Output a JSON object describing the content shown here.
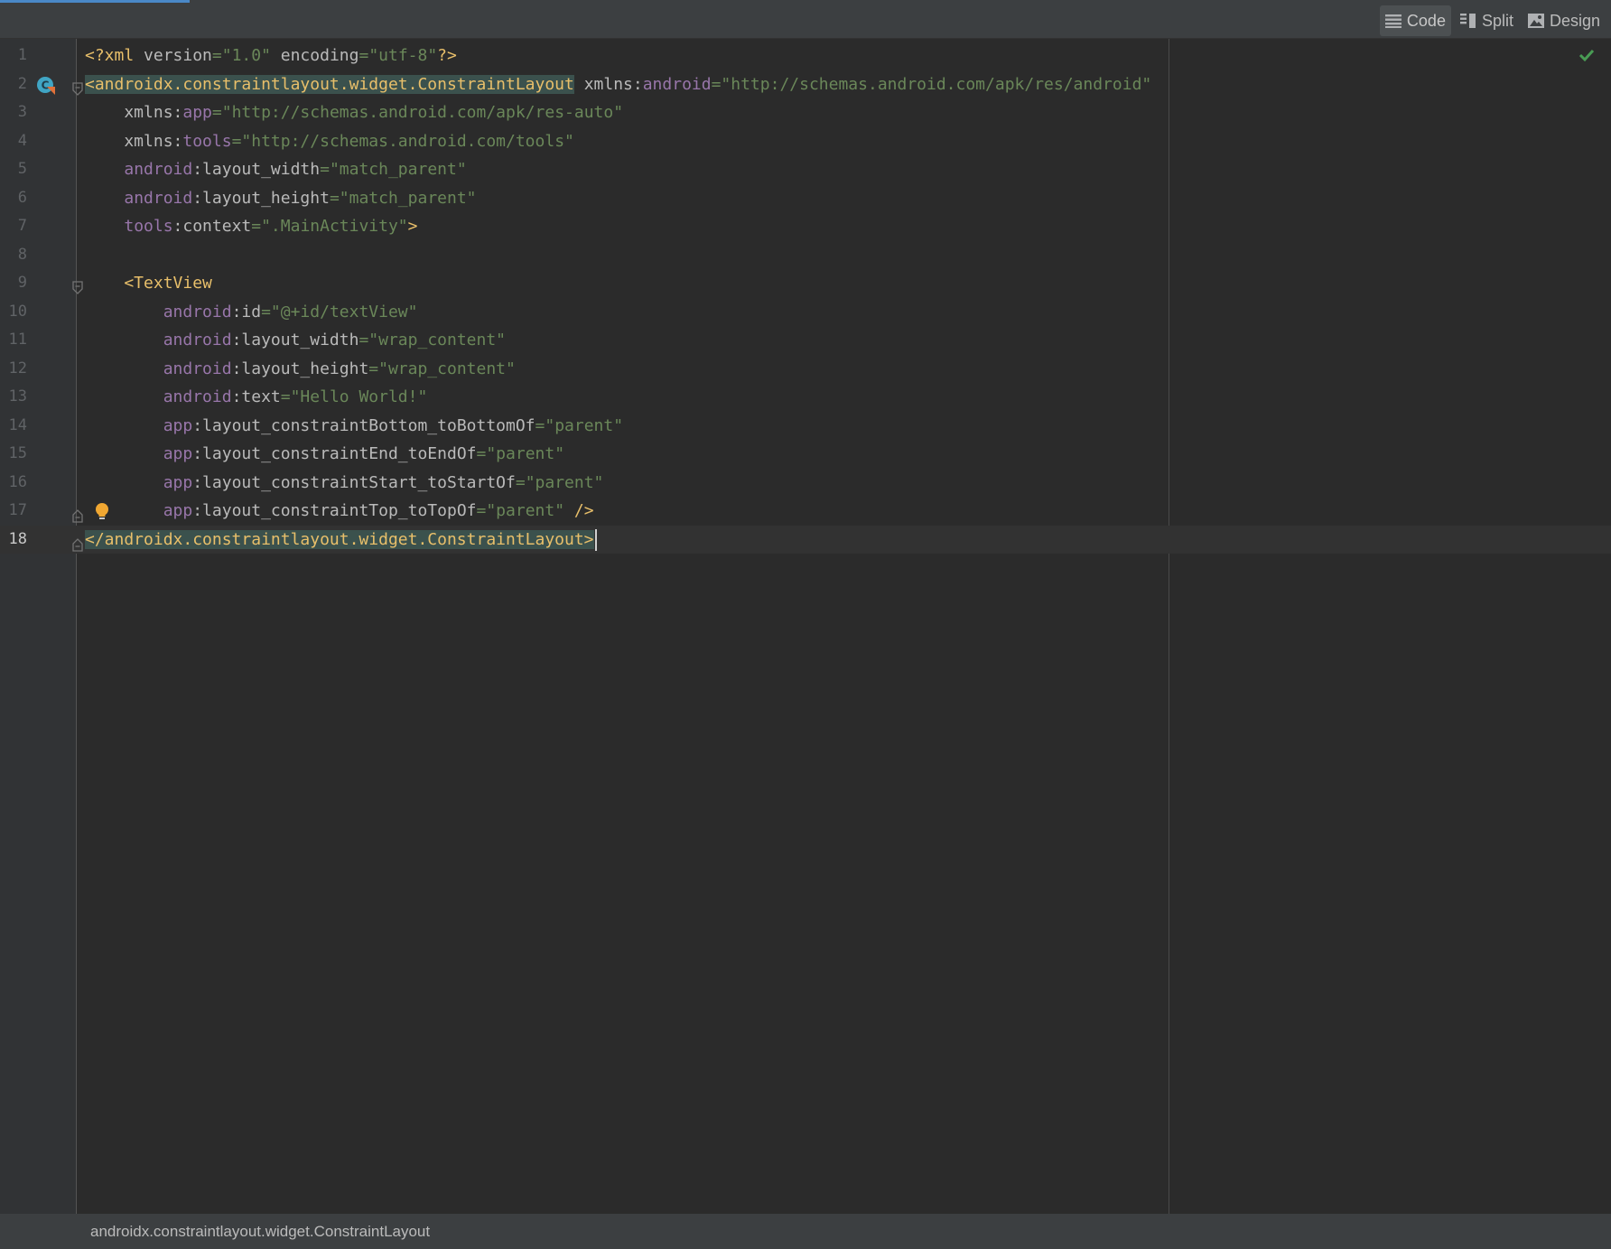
{
  "view_modes": {
    "code_label": "Code",
    "split_label": "Split",
    "design_label": "Design",
    "active": "Code"
  },
  "editor": {
    "current_line": 18,
    "lines": [
      {
        "n": "1",
        "tokens": [
          [
            "<?xml ",
            "t"
          ],
          [
            "version",
            "a"
          ],
          [
            "=",
            "v"
          ],
          [
            "\"1.0\"",
            "v"
          ],
          [
            " encoding",
            "a"
          ],
          [
            "=",
            "v"
          ],
          [
            "\"utf-8\"",
            "v"
          ],
          [
            "?>",
            "t"
          ]
        ]
      },
      {
        "n": "2",
        "tokens": [
          [
            "<androidx.constraintlayout.widget.ConstraintLayout",
            "t hl"
          ],
          [
            " xmlns:",
            "a"
          ],
          [
            "android",
            "ns"
          ],
          [
            "=",
            "v"
          ],
          [
            "\"http://schemas.android.com/apk/res/android\"",
            "v"
          ]
        ]
      },
      {
        "n": "3",
        "tokens": [
          [
            "    xmlns:",
            "a"
          ],
          [
            "app",
            "ns"
          ],
          [
            "=",
            "v"
          ],
          [
            "\"http://schemas.android.com/apk/res-auto\"",
            "v"
          ]
        ]
      },
      {
        "n": "4",
        "tokens": [
          [
            "    xmlns:",
            "a"
          ],
          [
            "tools",
            "ns"
          ],
          [
            "=",
            "v"
          ],
          [
            "\"http://schemas.android.com/tools\"",
            "v"
          ]
        ]
      },
      {
        "n": "5",
        "tokens": [
          [
            "    ",
            "a"
          ],
          [
            "android",
            "ns"
          ],
          [
            ":layout_width",
            "a"
          ],
          [
            "=",
            "v"
          ],
          [
            "\"match_parent\"",
            "v"
          ]
        ]
      },
      {
        "n": "6",
        "tokens": [
          [
            "    ",
            "a"
          ],
          [
            "android",
            "ns"
          ],
          [
            ":layout_height",
            "a"
          ],
          [
            "=",
            "v"
          ],
          [
            "\"match_parent\"",
            "v"
          ]
        ]
      },
      {
        "n": "7",
        "tokens": [
          [
            "    ",
            "a"
          ],
          [
            "tools",
            "ns"
          ],
          [
            ":context",
            "a"
          ],
          [
            "=",
            "v"
          ],
          [
            "\".MainActivity\"",
            "v"
          ],
          [
            ">",
            "t"
          ]
        ]
      },
      {
        "n": "8",
        "tokens": []
      },
      {
        "n": "9",
        "tokens": [
          [
            "    <TextView",
            "t"
          ]
        ]
      },
      {
        "n": "10",
        "tokens": [
          [
            "        ",
            "a"
          ],
          [
            "android",
            "ns"
          ],
          [
            ":id",
            "a"
          ],
          [
            "=",
            "v"
          ],
          [
            "\"@+id/textView\"",
            "v"
          ]
        ]
      },
      {
        "n": "11",
        "tokens": [
          [
            "        ",
            "a"
          ],
          [
            "android",
            "ns"
          ],
          [
            ":layout_width",
            "a"
          ],
          [
            "=",
            "v"
          ],
          [
            "\"wrap_content\"",
            "v"
          ]
        ]
      },
      {
        "n": "12",
        "tokens": [
          [
            "        ",
            "a"
          ],
          [
            "android",
            "ns"
          ],
          [
            ":layout_height",
            "a"
          ],
          [
            "=",
            "v"
          ],
          [
            "\"wrap_content\"",
            "v"
          ]
        ]
      },
      {
        "n": "13",
        "tokens": [
          [
            "        ",
            "a"
          ],
          [
            "android",
            "ns"
          ],
          [
            ":text",
            "a"
          ],
          [
            "=",
            "v"
          ],
          [
            "\"Hello World!\"",
            "v"
          ]
        ]
      },
      {
        "n": "14",
        "tokens": [
          [
            "        ",
            "a"
          ],
          [
            "app",
            "ns"
          ],
          [
            ":layout_constraintBottom_toBottomOf",
            "a"
          ],
          [
            "=",
            "v"
          ],
          [
            "\"parent\"",
            "v"
          ]
        ]
      },
      {
        "n": "15",
        "tokens": [
          [
            "        ",
            "a"
          ],
          [
            "app",
            "ns"
          ],
          [
            ":layout_constraintEnd_toEndOf",
            "a"
          ],
          [
            "=",
            "v"
          ],
          [
            "\"parent\"",
            "v"
          ]
        ]
      },
      {
        "n": "16",
        "tokens": [
          [
            "        ",
            "a"
          ],
          [
            "app",
            "ns"
          ],
          [
            ":layout_constraintStart_toStartOf",
            "a"
          ],
          [
            "=",
            "v"
          ],
          [
            "\"parent\"",
            "v"
          ]
        ]
      },
      {
        "n": "17",
        "tokens": [
          [
            "        ",
            "a"
          ],
          [
            "app",
            "ns"
          ],
          [
            ":layout_constraintTop_toTopOf",
            "a"
          ],
          [
            "=",
            "v"
          ],
          [
            "\"parent\"",
            "v"
          ],
          [
            " />",
            "t"
          ]
        ]
      },
      {
        "n": "18",
        "tokens": [
          [
            "</androidx.constraintlayout.widget.ConstraintLayout>",
            "t hl"
          ]
        ]
      }
    ]
  },
  "breadcrumb": "androidx.constraintlayout.widget.ConstraintLayout",
  "colors": {
    "tag": "#e8bf6a",
    "attribute": "#bababa",
    "namespace": "#9876aa",
    "value": "#6a8759",
    "accent": "#4a88c7",
    "check": "#499c54",
    "bulb": "#f0a732"
  }
}
